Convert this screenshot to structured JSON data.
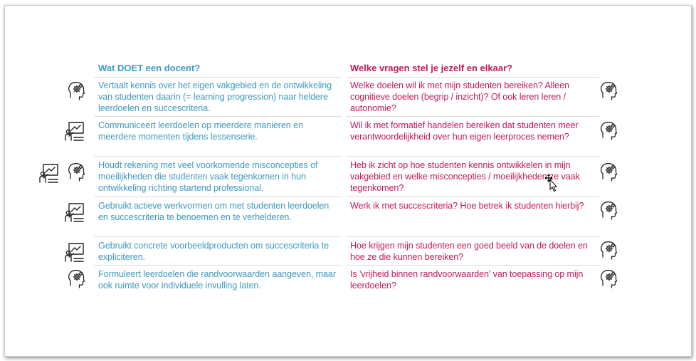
{
  "header": {
    "left": "Wat DOET een docent?",
    "right": "Welke vragen stel je jezelf en elkaar?"
  },
  "colors": {
    "left_text": "#3e9ac1",
    "right_text": "#c3195c"
  },
  "rows": [
    {
      "left": "Vertaalt kennis over het eigen vakgebied en de ontwikkeling van studenten daarin (= learning progression) naar heldere leerdoelen en succescriteria.",
      "right": "Welke doelen wil ik met mijn studenten bereiken? Alleen cognitieve doelen (begrip / inzicht)? Of ook leren leren / autonomie?",
      "left_icons": [
        "head-gear-icon"
      ],
      "right_icon": "head-gear-icon"
    },
    {
      "left": "Communiceert leerdoelen op meerdere manieren en meerdere momenten tijdens lessenserie.",
      "right": "Wil ik met formatief handelen bereiken dat studenten meer verantwoordelijkheid over hun eigen leerproces nemen?",
      "left_icons": [
        "teacher-board-icon"
      ],
      "right_icon": "head-gear-icon"
    },
    {
      "left": "Houdt rekening met veel voorkomende misconcepties of moeilijkheden die studenten vaak tegenkomen in hun ontwikkeling richting startend professional.",
      "right": "Heb ik zicht op hoe studenten kennis ontwikkelen in mijn vakgebied en welke misconcepties / moeilijkheden ze vaak tegenkomen?",
      "left_icons": [
        "teacher-board-icon",
        "head-gear-icon"
      ],
      "right_icon": "head-gear-icon"
    },
    {
      "left": "Gebruikt actieve werkvormen om met studenten leerdoelen en succescriteria te benoemen en te verhelderen.",
      "right": "Werk ik met succescriteria? Hoe betrek ik studenten hierbij?",
      "left_icons": [
        "teacher-board-icon"
      ],
      "right_icon": "head-gear-icon"
    },
    {
      "left": "Gebruikt concrete voorbeeldproducten om succescriteria te expliciteren.",
      "right": "Hoe krijgen mijn studenten een goed beeld van de doelen en hoe ze die kunnen bereiken?",
      "left_icons": [
        "teacher-board-icon"
      ],
      "right_icon": "head-gear-icon"
    },
    {
      "left": "Formuleert leerdoelen die randvoorwaarden aangeven, maar ook ruimte voor individuele invulling laten.",
      "right": "Is 'vrijheid binnen randvoorwaarden' van toepassing op mijn leerdoelen?",
      "left_icons": [
        "head-gear-icon"
      ],
      "right_icon": "head-gear-icon"
    }
  ]
}
